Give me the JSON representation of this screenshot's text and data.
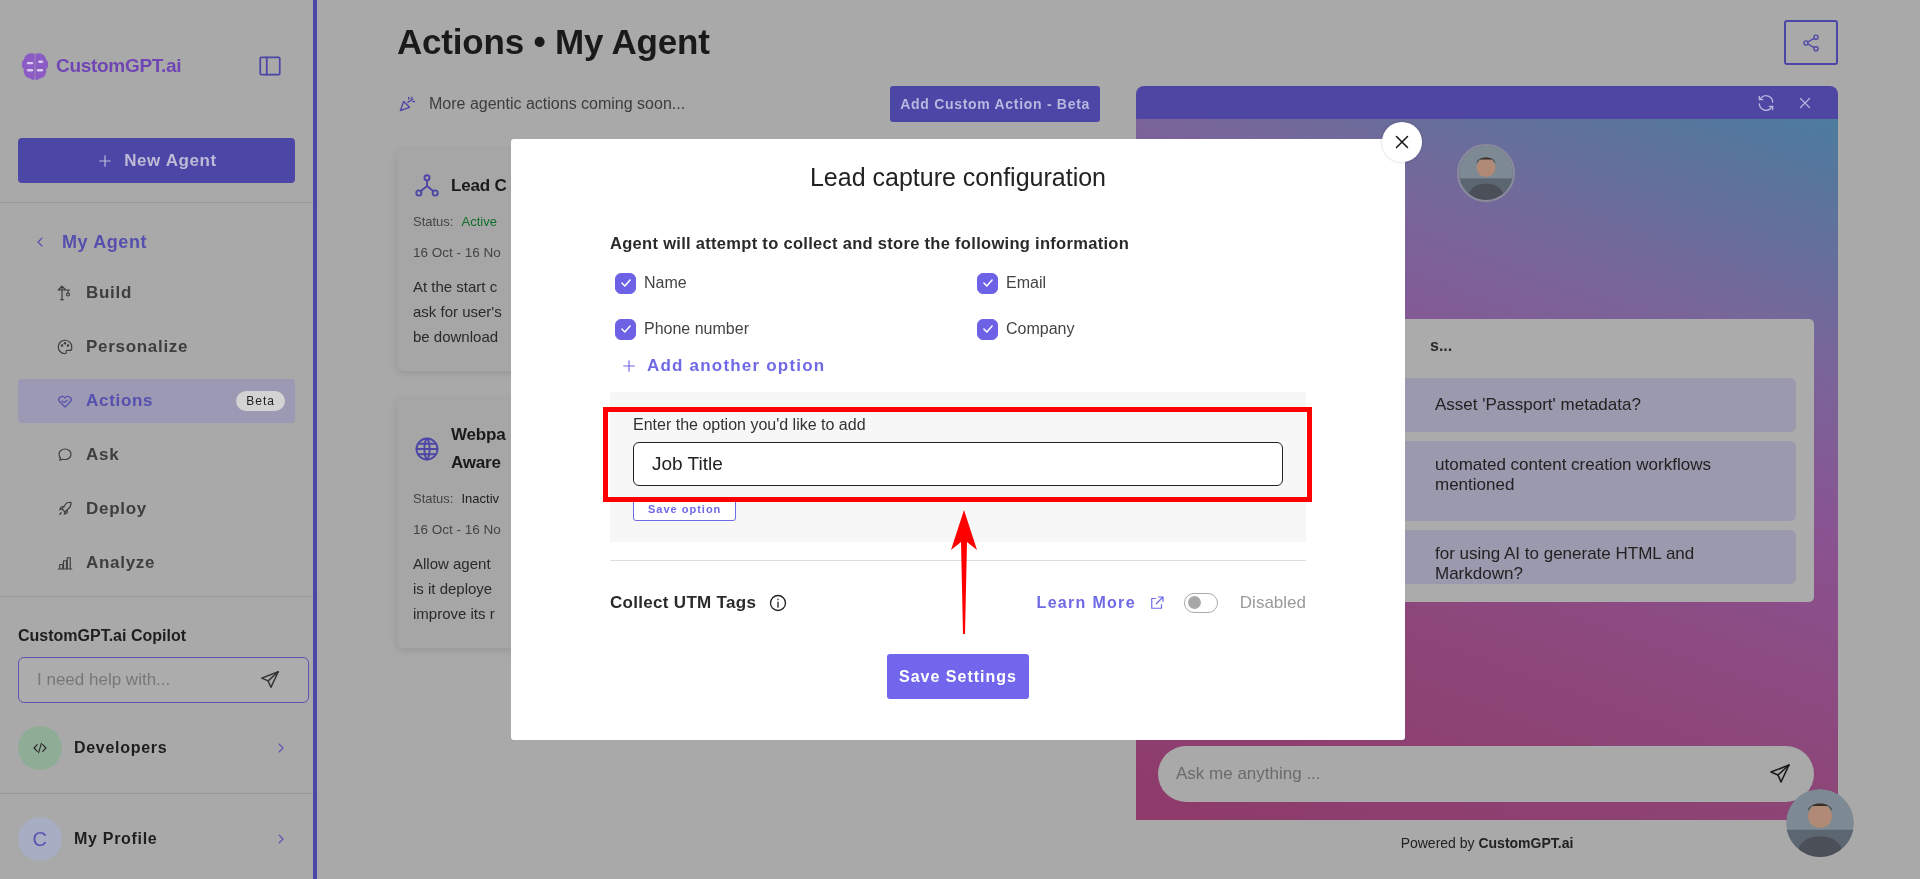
{
  "sidebar": {
    "brand": "CustomGPT.ai",
    "new_agent_button": "New Agent",
    "back_item": "My Agent",
    "nav": [
      {
        "label": "Build",
        "selected": false
      },
      {
        "label": "Personalize",
        "selected": false
      },
      {
        "label": "Actions",
        "badge": "Beta",
        "selected": true
      },
      {
        "label": "Ask",
        "selected": false
      },
      {
        "label": "Deploy",
        "selected": false
      },
      {
        "label": "Analyze",
        "selected": false
      }
    ],
    "copilot": {
      "title": "CustomGPT.ai Copilot",
      "placeholder": "I need help with..."
    },
    "developers": {
      "label": "Developers"
    },
    "profile": {
      "initial": "C",
      "label": "My Profile"
    }
  },
  "main": {
    "title": "Actions • My Agent",
    "notice": "More agentic actions coming soon...",
    "add_button": "Add Custom Action - Beta",
    "cards": [
      {
        "title_lines": [
          "Lead C"
        ],
        "status_label": "Status:",
        "status": "Active",
        "active": true,
        "dates": "16 Oct - 16 No",
        "description_lines": [
          "At the start c",
          "ask for user's",
          "be download"
        ]
      },
      {
        "title_lines": [
          "Webpa",
          "Aware"
        ],
        "status_label": "Status:",
        "status": "Inactiv",
        "active": false,
        "dates": "16 Oct - 16 No",
        "description_lines": [
          "Allow agent",
          "is it deploye",
          "improve its r"
        ]
      }
    ]
  },
  "chat": {
    "suggestions_heading": "s...",
    "suggestions": [
      "Asset 'Passport' metadata?",
      "utomated content creation workflows mentioned",
      "for using AI to generate HTML and Markdown?"
    ],
    "placeholder": "Ask me anything ...",
    "powered_by": "Powered by **CustomGPT.ai**"
  },
  "modal": {
    "title": "Lead capture configuration",
    "heading": "Agent will attempt to collect and store the following information",
    "fields": [
      {
        "label": "Name",
        "checked": true
      },
      {
        "label": "Email",
        "checked": true
      },
      {
        "label": "Phone number",
        "checked": true
      },
      {
        "label": "Company",
        "checked": true
      }
    ],
    "add_option": "Add another option",
    "new_option": {
      "label": "Enter the option you'd like to add",
      "value": "Job Title",
      "save_button": "Save option"
    },
    "utm": {
      "label": "Collect UTM Tags",
      "learn_more": "Learn More",
      "on": false,
      "state_text": "Disabled"
    },
    "save_button": "Save Settings"
  }
}
